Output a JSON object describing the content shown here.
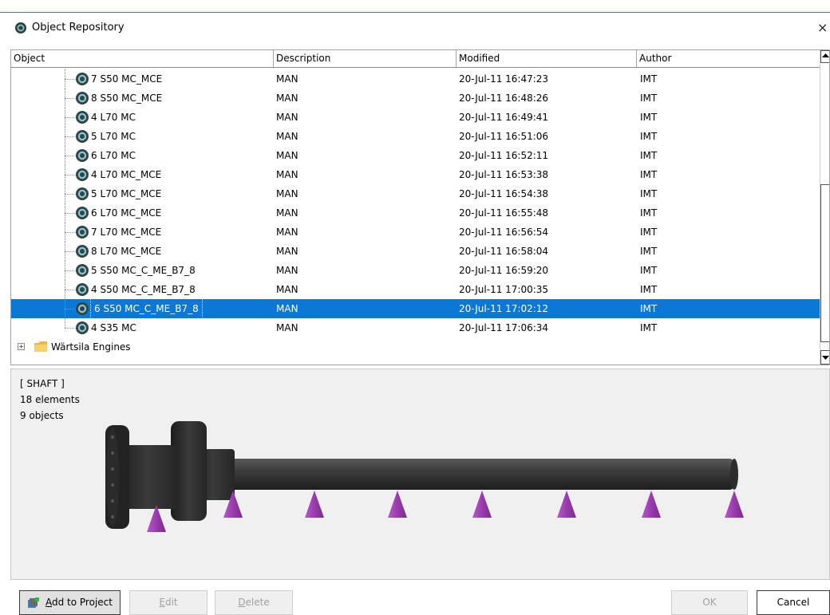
{
  "window": {
    "title": "Object Repository",
    "close_glyph": "×",
    "icon": "repository-ring-icon"
  },
  "columns": [
    "Object",
    "Description",
    "Modified",
    "Author"
  ],
  "rows": [
    {
      "object": "7 S50 MC_MCE",
      "description": "MAN",
      "modified": "20-Jul-11 16:47:23",
      "author": "IMT"
    },
    {
      "object": "8 S50 MC_MCE",
      "description": "MAN",
      "modified": "20-Jul-11 16:48:26",
      "author": "IMT"
    },
    {
      "object": "4 L70 MC",
      "description": "MAN",
      "modified": "20-Jul-11 16:49:41",
      "author": "IMT"
    },
    {
      "object": "5 L70 MC",
      "description": "MAN",
      "modified": "20-Jul-11 16:51:06",
      "author": "IMT"
    },
    {
      "object": "6 L70 MC",
      "description": "MAN",
      "modified": "20-Jul-11 16:52:11",
      "author": "IMT"
    },
    {
      "object": "4 L70 MC_MCE",
      "description": "MAN",
      "modified": "20-Jul-11 16:53:38",
      "author": "IMT"
    },
    {
      "object": "5 L70 MC_MCE",
      "description": "MAN",
      "modified": "20-Jul-11 16:54:38",
      "author": "IMT"
    },
    {
      "object": "6 L70 MC_MCE",
      "description": "MAN",
      "modified": "20-Jul-11 16:55:48",
      "author": "IMT"
    },
    {
      "object": "7 L70 MC_MCE",
      "description": "MAN",
      "modified": "20-Jul-11 16:56:54",
      "author": "IMT"
    },
    {
      "object": "8 L70 MC_MCE",
      "description": "MAN",
      "modified": "20-Jul-11 16:58:04",
      "author": "IMT"
    },
    {
      "object": "5 S50 MC_C_ME_B7_8",
      "description": "MAN",
      "modified": "20-Jul-11 16:59:20",
      "author": "IMT"
    },
    {
      "object": "4 S50 MC_C_ME_B7_8",
      "description": "MAN",
      "modified": "20-Jul-11 17:00:35",
      "author": "IMT"
    },
    {
      "object": "6 S50 MC_C_ME_B7_8",
      "description": "MAN",
      "modified": "20-Jul-11 17:02:12",
      "author": "IMT",
      "selected": true
    },
    {
      "object": "4 S35 MC",
      "description": "MAN",
      "modified": "20-Jul-11 17:06:34",
      "author": "IMT"
    }
  ],
  "folder": {
    "label": "Wärtsila Engines",
    "expander": "+",
    "icon": "folder-icon"
  },
  "preview": {
    "type_label": "[ SHAFT ]",
    "elements": "18 elements",
    "objects": "9 objects",
    "support_color": "#a23fb5",
    "shaft_color": "#3a3a3a"
  },
  "buttons": {
    "add_prefix": "",
    "add_underline": "A",
    "add_rest": "dd to Project",
    "edit_underline": "E",
    "edit_rest": "dit",
    "delete_underline": "D",
    "delete_rest": "elete",
    "ok": "OK",
    "cancel": "Cancel"
  },
  "colors": {
    "selection": "#0d77d6",
    "title_accent": "#2b79d0"
  }
}
